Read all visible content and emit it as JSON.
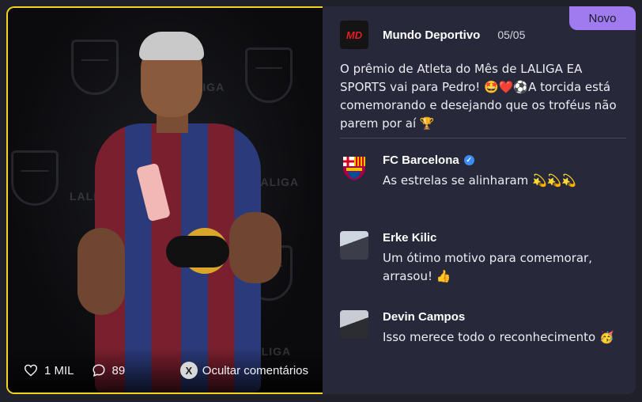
{
  "badge": {
    "label": "Novo"
  },
  "post": {
    "author": "Mundo Deportivo",
    "logo_text": "MD",
    "date": "05/05",
    "text": "O prêmio de Atleta do Mês de LALIGA EA SPORTS vai para Pedro! 🤩❤️⚽A torcida está comemorando e desejando que os troféus não parem por aí 🏆"
  },
  "media": {
    "likes": "1 MIL",
    "comments": "89",
    "hide_button_glyph": "X",
    "hide_comments_label": "Ocultar comentários",
    "backdrop_text": "LALIGA"
  },
  "comments": [
    {
      "name": "FC Barcelona",
      "verified": true,
      "text": "As estrelas se alinharam 💫💫💫",
      "avatar_icon": "fc-barcelona-crest-icon"
    },
    {
      "name": "Erke Kilic",
      "verified": false,
      "text": "Um ótimo motivo para comemorar, arrasou! 👍",
      "avatar_icon": "user-avatar"
    },
    {
      "name": "Devin Campos",
      "verified": false,
      "text": "Isso merece todo o reconhecimento 🥳",
      "avatar_icon": "user-avatar"
    }
  ],
  "colors": {
    "accent_border": "#f4d41f",
    "badge": "#a07bf0",
    "panel": "#27283a",
    "verified": "#3d8bf5"
  }
}
